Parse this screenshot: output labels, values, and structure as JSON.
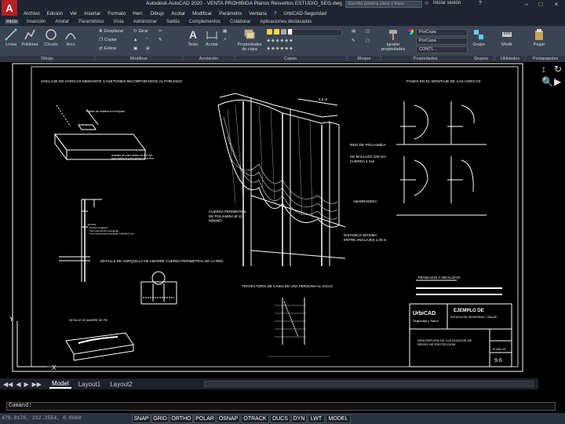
{
  "titlebar": {
    "logo": "A",
    "title": "Autodesk AutoCAD 2020 - VENTA PROHIBIDA   Planos Resueltos ESTUDIO_SEG.dwg",
    "search_placeholder": "Escriba palabra clave o frase",
    "login": "Iniciar sesión"
  },
  "menu": [
    "Archivo",
    "Edición",
    "Ver",
    "Insertar",
    "Formato",
    "Herr.",
    "Dibujo",
    "Acotar",
    "Modificar",
    "Parámetro",
    "Ventana",
    "?",
    "UrbiCAD-Seguridad"
  ],
  "ribbon_tabs": [
    "Inicio",
    "Inserción",
    "Anotar",
    "Paramétrico",
    "Vista",
    "Administrar",
    "Salida",
    "Complementos",
    "Colaborar",
    "Aplicaciones destacadas"
  ],
  "ribbon": {
    "draw": {
      "title": "Dibujo",
      "tools": [
        "Línea",
        "Polilínea",
        "Círculo",
        "Arco"
      ]
    },
    "modify": {
      "title": "Modificar",
      "tools": [
        "Desplazar",
        "Girar",
        "Copiar",
        "Estirar"
      ]
    },
    "annotation": {
      "title": "Anotación",
      "tools": [
        "Texto",
        "Acotar"
      ]
    },
    "layers": {
      "title": "Capas",
      "properties_label": "Propiedades de capa"
    },
    "block": {
      "title": "Bloque",
      "insert_label": "Insertar"
    },
    "properties": {
      "title": "Propiedades",
      "match_label": "Igualar propiedades",
      "color": "PorCapa",
      "linetype": "PorCapa",
      "lineweight": "CONTI..."
    },
    "groups": {
      "title": "Grupos",
      "label": "Grupo"
    },
    "utilities": {
      "title": "Utilidades",
      "label": "Medir"
    },
    "clipboard": {
      "title": "Portapapeles",
      "label": "Pegar"
    }
  },
  "drawing": {
    "title_anchor": "ANCLAJE DE HORCAS MEDIANTE CASETONES INCORPORADOS AL FORJADO",
    "cuna": "Cajetín de madera en el forjado",
    "anchor_note": "Anclajes de cuero doblez de Ø 8 mm\npara sujetar la pieza inferior de la Red",
    "fases": "FASES EN EL MONTAJE DE LAS HORCAS",
    "net_label": "RED DE POLIAMIDA",
    "mesh": "DE MALLAZO 100 mm\nCUERDA 4 mm",
    "perim": "CUERDA PERIMETRAL\nDE POLIAMIDA Ø 12\nMÍNIMO",
    "atado": "AMARRADERA",
    "dist": "DISTANCIA MÁXIMA\nENTRE ANCLAJES 1,00 m",
    "dim_top": "4,5 m",
    "horquilla": "DETALLE DE HORQUILLA DE AMARRE CUERDA PERIMETRAL DE LA RED",
    "trayectoria": "TRAYECTORIA DE CAIDA DE UNA PERSONA AL VACIO",
    "detalle_pie": "DETALLE DE AMARRE DE PIE",
    "trabajos": "TRABAJOS A REALIZAR",
    "ejemplo": "EJEMPLO DE",
    "ejemplo_sub": "ESTUDIO DE SEGURIDAD Y SALUD",
    "urbicad": "UrbiCAD",
    "urbicad_sub": "Seguridad y Salud",
    "descripcion": "DESCRIPCION DE COLOCACION DE\nREDES DE PROTECCION",
    "plano_label": "PLANO Nº",
    "plano_num": "9.6",
    "note_small": "NOTAS:\n- Perfiles metálicos\n- Tubo estructural rectangular\n- Tubo estructural rectangular 100x60x3 mm"
  },
  "sheet_tabs": [
    "Model",
    "Layout1",
    "Layout2"
  ],
  "command": {
    "prompt": "Comand:"
  },
  "status": {
    "coords": "479.0176, 212.2554, 0.0000",
    "toggles": [
      "SNAP",
      "GRID",
      "ORTHO",
      "POLAR",
      "OSNAP",
      "OTRACK",
      "DUCS",
      "DYN",
      "LWT",
      "MODEL"
    ]
  },
  "colors": {
    "accent": "#b51f24",
    "ribbon": "#3b4453",
    "canvas": "#000000"
  }
}
